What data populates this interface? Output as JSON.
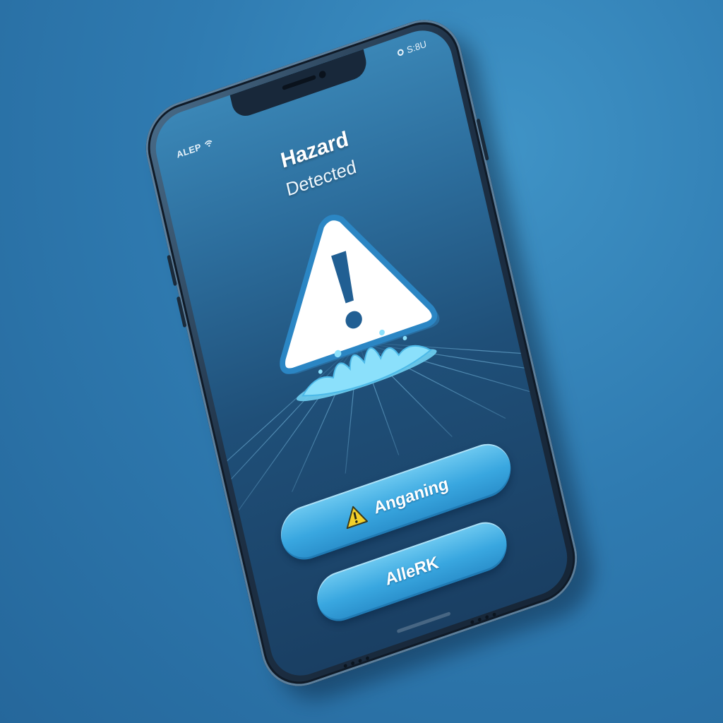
{
  "status_bar": {
    "left_label": "ALEP",
    "right_label": "S:8U"
  },
  "alert": {
    "title": "Hazard",
    "subtitle": "Detected"
  },
  "buttons": {
    "primary_label": "Anganing",
    "secondary_label": "AlleRK"
  },
  "colors": {
    "background": "#2f79ae",
    "button": "#39a7e0",
    "warning_yellow": "#f2d02a"
  },
  "icons": {
    "hazard": "warning-triangle-icon",
    "spill": "water-splash-icon",
    "button_warning": "warning-small-icon"
  }
}
